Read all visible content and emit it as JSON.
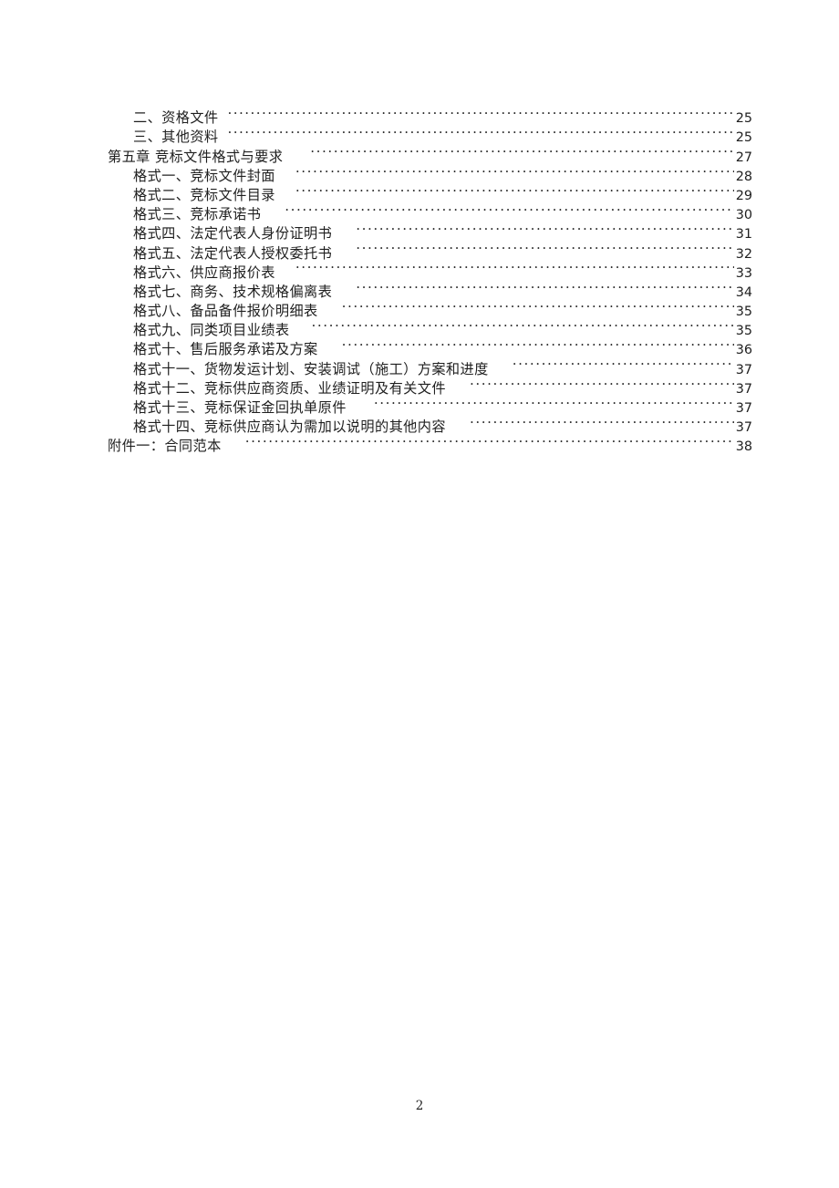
{
  "document": {
    "footer_page_number": "2"
  },
  "toc": {
    "entries": [
      {
        "level": "sub",
        "title": "二、资格文件",
        "page": "25",
        "tight": true,
        "lead_gap": 10
      },
      {
        "level": "sub",
        "title": "三、其他资料",
        "page": "25",
        "tight": true,
        "lead_gap": 10
      },
      {
        "level": "chap",
        "title": "第五章     竞标文件格式与要求",
        "page": "27",
        "tight": false,
        "lead_gap": 30
      },
      {
        "level": "sub",
        "title": "格式一、竞标文件封面",
        "page": "28",
        "tight": false,
        "lead_gap": 22
      },
      {
        "level": "sub",
        "title": "格式二、竞标文件目录",
        "page": "29",
        "tight": false,
        "lead_gap": 22
      },
      {
        "level": "sub",
        "title": "格式三、竞标承诺书",
        "page": "30",
        "tight": false,
        "lead_gap": 26
      },
      {
        "level": "sub",
        "title": "格式四、法定代表人身份证明书",
        "page": "31",
        "tight": false,
        "lead_gap": 26
      },
      {
        "level": "sub",
        "title": "格式五、法定代表人授权委托书",
        "page": "32",
        "tight": false,
        "lead_gap": 26
      },
      {
        "level": "sub",
        "title": "格式六、供应商报价表",
        "page": "33",
        "tight": false,
        "lead_gap": 22
      },
      {
        "level": "sub",
        "title": "格式七、商务、技术规格偏离表",
        "page": "34",
        "tight": false,
        "lead_gap": 26
      },
      {
        "level": "sub",
        "title": "格式八、备品备件报价明细表",
        "page": "35",
        "tight": false,
        "lead_gap": 26
      },
      {
        "level": "sub",
        "title": "格式九、同类项目业绩表",
        "page": "35",
        "tight": false,
        "lead_gap": 24
      },
      {
        "level": "sub",
        "title": "格式十、售后服务承诺及方案",
        "page": "36",
        "tight": false,
        "lead_gap": 26
      },
      {
        "level": "sub",
        "title": "格式十一、货物发运计划、安装调试（施工）方案和进度",
        "page": "37",
        "tight": false,
        "lead_gap": 26
      },
      {
        "level": "sub",
        "title": "格式十二、竞标供应商资质、业绩证明及有关文件",
        "page": "37",
        "tight": false,
        "lead_gap": 26
      },
      {
        "level": "sub",
        "title": "格式十三、竞标保证金回执单原件",
        "page": "37",
        "tight": false,
        "lead_gap": 30
      },
      {
        "level": "sub",
        "title": "格式十四、竞标供应商认为需加以说明的其他内容",
        "page": "37",
        "tight": false,
        "lead_gap": 26
      },
      {
        "level": "appx",
        "title": "附件一：合同范本",
        "page": "38",
        "tight": false,
        "lead_gap": 26
      }
    ]
  }
}
